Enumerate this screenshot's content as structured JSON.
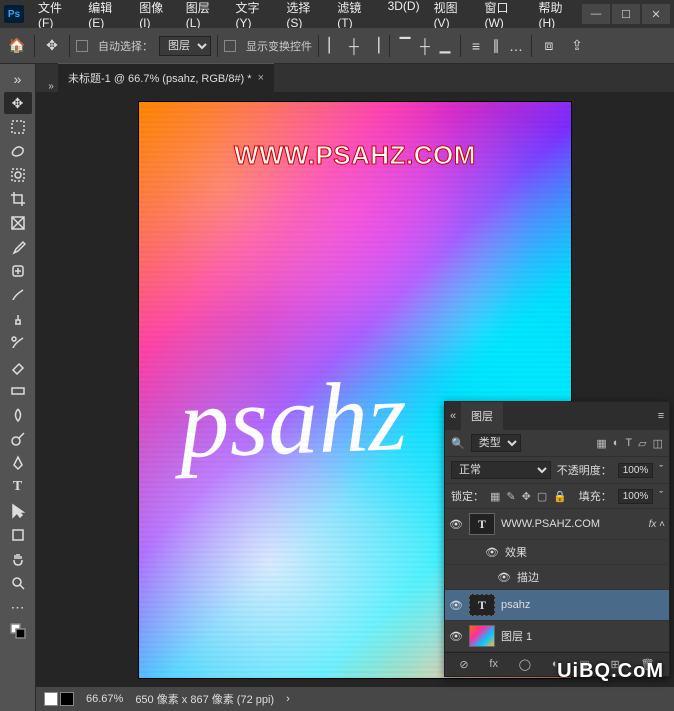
{
  "menu": [
    "文件(F)",
    "编辑(E)",
    "图像(I)",
    "图层(L)",
    "文字(Y)",
    "选择(S)",
    "滤镜(T)",
    "3D(D)",
    "视图(V)",
    "窗口(W)",
    "帮助(H)"
  ],
  "optbar": {
    "auto_select_label": "自动选择：",
    "target": "图层",
    "transform_label": "显示变换控件"
  },
  "tab": {
    "title": "未标题-1 @ 66.7% (psahz, RGB/8#) *"
  },
  "canvas": {
    "url": "WWW.PSAHZ.COM",
    "text": "psahz"
  },
  "status": {
    "zoom": "66.67%",
    "info": "650 像素 x 867 像素 (72 ppi)"
  },
  "layers": {
    "title": "图层",
    "filter_label": "类型",
    "blend": "正常",
    "opacity_label": "不透明度：",
    "opacity_value": "100%",
    "lock_label": "锁定：",
    "fill_label": "填充：",
    "fill_value": "100%",
    "items": [
      {
        "name": "WWW.PSAHZ.COM",
        "kind": "T",
        "fx": true
      },
      {
        "name": "效果",
        "kind": "fxhdr"
      },
      {
        "name": "描边",
        "kind": "fxitem"
      },
      {
        "name": "psahz",
        "kind": "T",
        "selected": true,
        "dashed": true
      },
      {
        "name": "图层 1",
        "kind": "img"
      }
    ]
  },
  "watermark": "UiBQ.CoM"
}
